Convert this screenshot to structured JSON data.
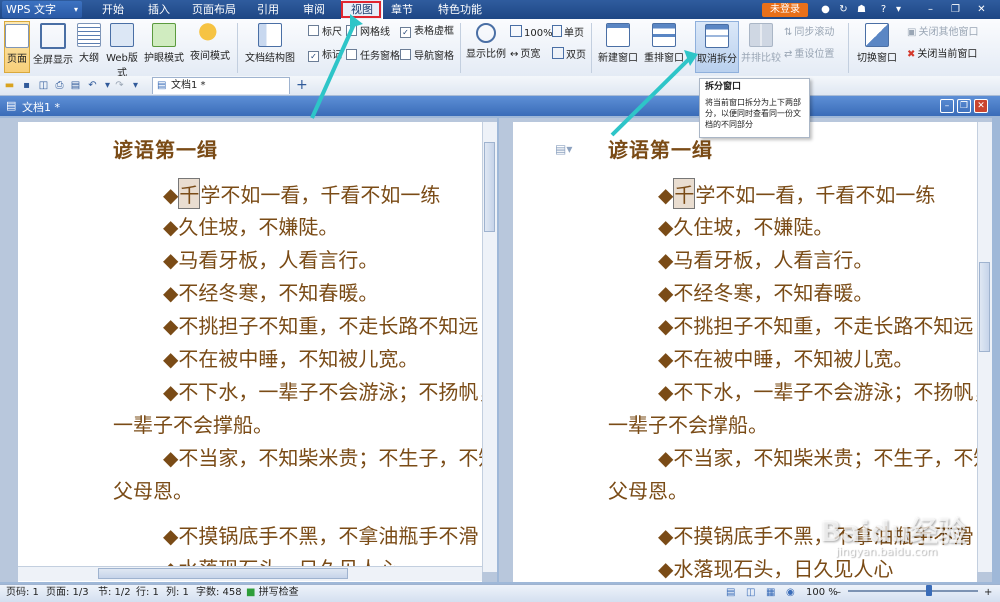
{
  "app": {
    "name": "WPS 文字"
  },
  "menu_tabs": [
    {
      "label": "开始"
    },
    {
      "label": "插入"
    },
    {
      "label": "页面布局"
    },
    {
      "label": "引用"
    },
    {
      "label": "审阅"
    },
    {
      "label": "视图"
    },
    {
      "label": "章节"
    },
    {
      "label": "特色功能"
    }
  ],
  "titlebar": {
    "login": "未登录"
  },
  "ribbon": {
    "page": "页面",
    "fullscreen": "全屏显示",
    "outline": "大纲",
    "web_layout": "Web版式",
    "eye_mode": "护眼模式",
    "night_mode": "夜间模式",
    "doc_structure": "文档结构图",
    "ruler": "标尺",
    "gridlines": "网格线",
    "table_gridlines": "表格虚框",
    "markers": "标记",
    "task_pane": "任务窗格",
    "nav_pane": "导航窗格",
    "zoom_ratio": "显示比例",
    "zoom_100": "100%",
    "page_width": "页宽",
    "single_page": "单页",
    "two_pages": "双页",
    "new_window": "新建窗口",
    "arrange_windows": "重排窗口",
    "cancel_split": "取消拆分",
    "side_by_side": "并排比较",
    "sync_scroll": "同步滚动",
    "reset_position": "重设位置",
    "switch_window": "切换窗口",
    "close_others": "关闭其他窗口",
    "close_current": "关闭当前窗口"
  },
  "tab": {
    "label": "文档1 *"
  },
  "docwindow": {
    "title": "文档1 *"
  },
  "tooltip": {
    "title": "拆分窗口",
    "body": "将当前窗口拆分为上下两部分，以便同时查看同一份文档的不同部分"
  },
  "document": {
    "title": "谚语第一缉",
    "lines": [
      {
        "text": "◆千学不如一看，千看不如一练",
        "indent": true,
        "cursor": true
      },
      {
        "text": "◆久住坡，不嫌陡。",
        "indent": true
      },
      {
        "text": "◆马看牙板，人看言行。",
        "indent": true
      },
      {
        "text": "◆不经冬寒，不知春暖。",
        "indent": true
      },
      {
        "text": "◆不挑担子不知重，不走长路不知远",
        "indent": true
      },
      {
        "text": "◆不在被中睡，不知被儿宽。",
        "indent": true
      },
      {
        "text": "◆不下水，一辈子不会游泳；不扬帆，",
        "indent": true
      },
      {
        "text": "一辈子不会撑船。",
        "indent": false
      },
      {
        "text": "◆不当家，不知柴米贵；不生子，不知",
        "indent": true
      },
      {
        "text": "父母恩。",
        "indent": false
      },
      {
        "text": "◆不摸锅底手不黑，不拿油瓶手不滑",
        "indent": true
      },
      {
        "text": "◆水落现石头，日久见人心",
        "indent": true
      }
    ]
  },
  "statusbar": {
    "page_code": "页码: 1",
    "page": "页面: 1/3",
    "section": "节: 1/2",
    "row": "行: 1",
    "col": "列: 1",
    "words": "字数: 458",
    "spellcheck": "拼写检查",
    "zoom": "100 %"
  },
  "watermark": {
    "brand": "Baidu经验",
    "url": "jingyan.baidu.com"
  },
  "colors": {
    "accent": "#3a6cb8",
    "highlight_box": "#e0262f",
    "arrow": "#2ec5c8",
    "doc_text": "#7a4b16"
  }
}
